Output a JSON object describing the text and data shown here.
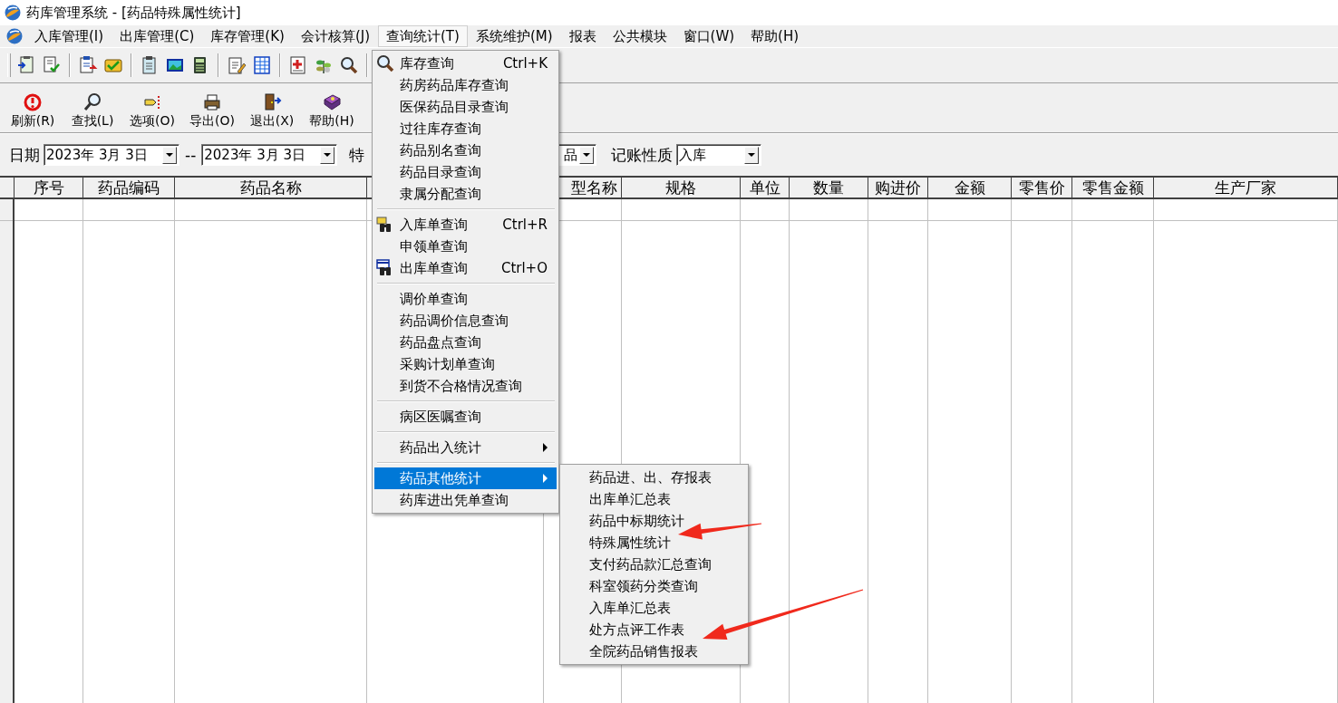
{
  "window": {
    "title": "药库管理系统 - [药品特殊属性统计]"
  },
  "menu_bar": [
    {
      "label": "入库管理(I)",
      "selected": false
    },
    {
      "label": "出库管理(C)",
      "selected": false
    },
    {
      "label": "库存管理(K)",
      "selected": false
    },
    {
      "label": "会计核算(J)",
      "selected": false
    },
    {
      "label": "查询统计(T)",
      "selected": true
    },
    {
      "label": "系统维护(M)",
      "selected": false
    },
    {
      "label": "报表",
      "selected": false
    },
    {
      "label": "公共模块",
      "selected": false
    },
    {
      "label": "窗口(W)",
      "selected": false
    },
    {
      "label": "帮助(H)",
      "selected": false
    }
  ],
  "action_buttons": [
    {
      "label": "刷新(R)"
    },
    {
      "label": "查找(L)"
    },
    {
      "label": "选项(O)"
    },
    {
      "label": "导出(O)"
    },
    {
      "label": "退出(X)"
    },
    {
      "label": "帮助(H)"
    }
  ],
  "filters": {
    "date_label": "日期",
    "date_from": "2023年 3月 3日",
    "range_separator": "--",
    "date_to": "2023年 3月 3日",
    "label_3": "特",
    "combo_3_value": "品",
    "account_label": "记账性质",
    "account_value": "入库"
  },
  "table": {
    "columns": [
      {
        "kind": "header",
        "label": "序号"
      },
      {
        "kind": "header",
        "label": "药品编码"
      },
      {
        "kind": "header",
        "label": "药品名称"
      },
      {
        "kind": "covered"
      },
      {
        "kind": "header",
        "label": "型名称"
      },
      {
        "kind": "header",
        "label": "规格"
      },
      {
        "kind": "header",
        "label": "单位"
      },
      {
        "kind": "header",
        "label": "数量"
      },
      {
        "kind": "header",
        "label": "购进价"
      },
      {
        "kind": "header",
        "label": "金额"
      },
      {
        "kind": "header",
        "label": "零售价"
      },
      {
        "kind": "header",
        "label": "零售金额"
      },
      {
        "kind": "header",
        "label": "生产厂家"
      }
    ]
  },
  "query_menu": {
    "items": [
      {
        "kind": "item",
        "label": "库存查询",
        "shortcut": "Ctrl+K",
        "selected": false
      },
      {
        "kind": "item",
        "label": "药房药品库存查询",
        "selected": false
      },
      {
        "kind": "item",
        "label": "医保药品目录查询",
        "selected": false
      },
      {
        "kind": "item",
        "label": "过往库存查询",
        "selected": false
      },
      {
        "kind": "item",
        "label": "药品别名查询",
        "selected": false
      },
      {
        "kind": "item",
        "label": "药品目录查询",
        "selected": false
      },
      {
        "kind": "item",
        "label": "隶属分配查询",
        "selected": false
      },
      {
        "kind": "separator"
      },
      {
        "kind": "item",
        "label": "入库单查询",
        "shortcut": "Ctrl+R",
        "selected": false
      },
      {
        "kind": "item",
        "label": "申领单查询",
        "selected": false
      },
      {
        "kind": "item",
        "label": "出库单查询",
        "shortcut": "Ctrl+O",
        "selected": false
      },
      {
        "kind": "separator"
      },
      {
        "kind": "item",
        "label": "调价单查询",
        "selected": false
      },
      {
        "kind": "item",
        "label": "药品调价信息查询",
        "selected": false
      },
      {
        "kind": "item",
        "label": "药品盘点查询",
        "selected": false
      },
      {
        "kind": "item",
        "label": "采购计划单查询",
        "selected": false
      },
      {
        "kind": "item",
        "label": "到货不合格情况查询",
        "selected": false
      },
      {
        "kind": "separator"
      },
      {
        "kind": "item",
        "label": "病区医嘱查询",
        "selected": false
      },
      {
        "kind": "separator"
      },
      {
        "kind": "submenu",
        "label": "药品出入统计",
        "selected": false
      },
      {
        "kind": "separator"
      },
      {
        "kind": "submenu",
        "label": "药品其他统计",
        "selected": true,
        "children": [
          {
            "label": "药品进、出、存报表",
            "selected": false
          },
          {
            "label": "出库单汇总表",
            "selected": false
          },
          {
            "label": "药品中标期统计",
            "selected": false
          },
          {
            "label": "特殊属性统计",
            "selected": false
          },
          {
            "label": "支付药品款汇总查询",
            "selected": false
          },
          {
            "label": "科室领药分类查询",
            "selected": false
          },
          {
            "label": "入库单汇总表",
            "selected": false
          },
          {
            "label": "处方点评工作表",
            "selected": false
          },
          {
            "label": "全院药品销售报表",
            "selected": false
          }
        ]
      },
      {
        "kind": "item",
        "label": "药库进出凭单查询",
        "selected": false
      }
    ]
  }
}
